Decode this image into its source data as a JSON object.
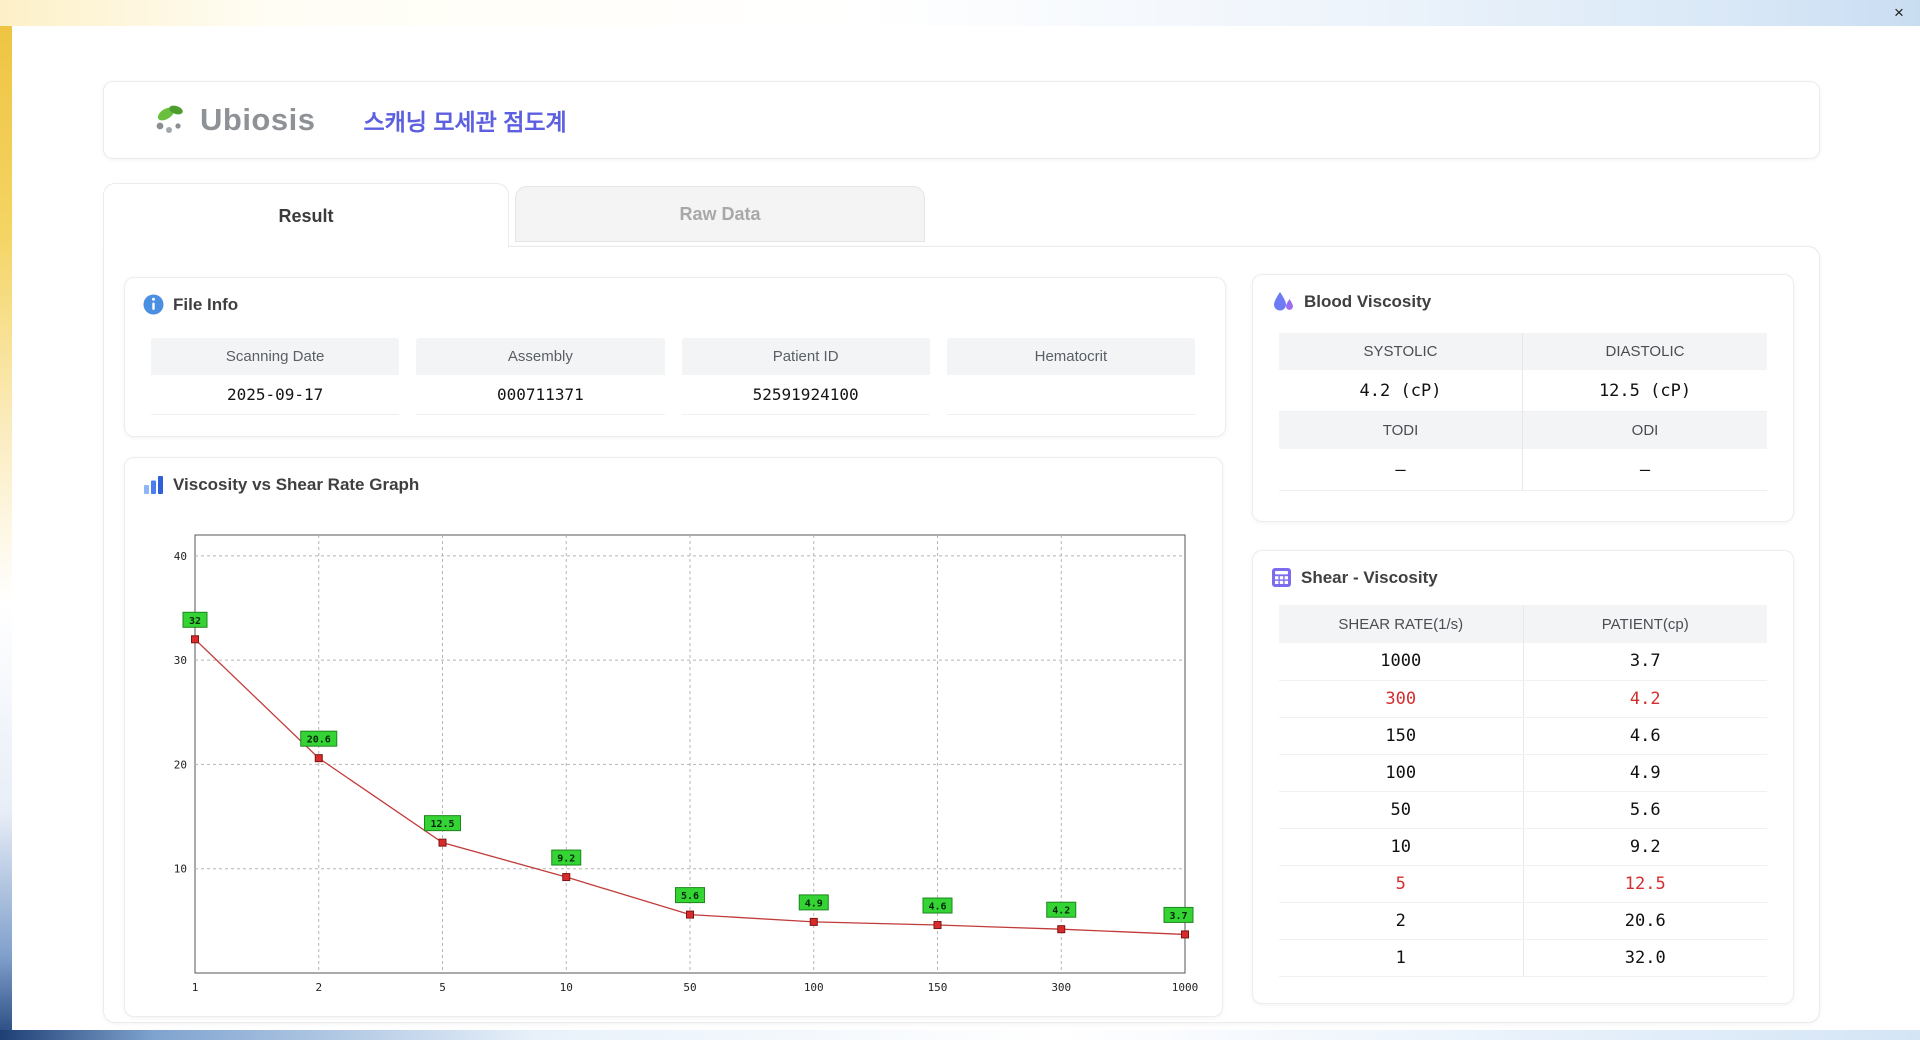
{
  "window": {
    "close_label": "×"
  },
  "header": {
    "brand": "Ubiosis",
    "title": "스캐닝 모세관 점도계"
  },
  "tabs": {
    "result": "Result",
    "raw_data": "Raw Data"
  },
  "file_info": {
    "title": "File Info",
    "fields": [
      {
        "label": "Scanning Date",
        "value": "2025-09-17"
      },
      {
        "label": "Assembly",
        "value": "000711371"
      },
      {
        "label": "Patient ID",
        "value": "52591924100"
      },
      {
        "label": "Hematocrit",
        "value": ""
      }
    ]
  },
  "graph": {
    "title": "Viscosity vs Shear Rate Graph"
  },
  "chart_data": {
    "type": "line",
    "title": "Viscosity vs Shear Rate Graph",
    "x_categories": [
      "1",
      "2",
      "5",
      "10",
      "50",
      "100",
      "150",
      "300",
      "1000"
    ],
    "values": [
      32,
      20.6,
      12.5,
      9.2,
      5.6,
      4.9,
      4.6,
      4.2,
      3.7
    ],
    "point_labels": [
      "32",
      "20.6",
      "12.5",
      "9.2",
      "5.6",
      "4.9",
      "4.6",
      "4.2",
      "3.7"
    ],
    "y_ticks": [
      10,
      20,
      30,
      40
    ],
    "ylim": [
      0,
      42
    ],
    "x_scale": "category",
    "grid": "dashed",
    "legend": "none",
    "xlabel": "",
    "ylabel": "",
    "line_color": "#c23b3b",
    "marker_color": "#d92b2b",
    "marker_border": "#7d1414",
    "label_bg": "#35d435",
    "label_border": "#1d861d"
  },
  "blood_viscosity": {
    "title": "Blood Viscosity",
    "systolic_label": "SYSTOLIC",
    "systolic_value": "4.2 (cP)",
    "diastolic_label": "DIASTOLIC",
    "diastolic_value": "12.5 (cP)",
    "todi_label": "TODI",
    "todi_value": "–",
    "odi_label": "ODI",
    "odi_value": "–"
  },
  "shear_table": {
    "title": "Shear - Viscosity",
    "columns": [
      "SHEAR RATE(1/s)",
      "PATIENT(cp)"
    ],
    "rows": [
      {
        "shear": "1000",
        "patient": "3.7",
        "highlight": false
      },
      {
        "shear": "300",
        "patient": "4.2",
        "highlight": true
      },
      {
        "shear": "150",
        "patient": "4.6",
        "highlight": false
      },
      {
        "shear": "100",
        "patient": "4.9",
        "highlight": false
      },
      {
        "shear": "50",
        "patient": "5.6",
        "highlight": false
      },
      {
        "shear": "10",
        "patient": "9.2",
        "highlight": false
      },
      {
        "shear": "5",
        "patient": "12.5",
        "highlight": true
      },
      {
        "shear": "2",
        "patient": "20.6",
        "highlight": false
      },
      {
        "shear": "1",
        "patient": "32.0",
        "highlight": false
      }
    ],
    "highlight_color": "#d32f2f"
  },
  "colors": {
    "accent_blue": "#5b5fe0",
    "brand_green": "#6abf3f",
    "header_cell_bg": "#f3f4f6"
  }
}
